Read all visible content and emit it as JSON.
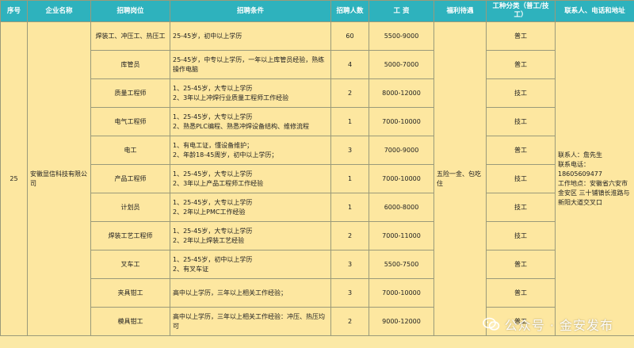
{
  "headers": {
    "seq": "序号",
    "company": "企业名称",
    "position": "招聘岗位",
    "conditions": "招聘条件",
    "count": "招聘人数",
    "salary": "工 资",
    "benefits": "福利待遇",
    "worktype": "工种分类（普工/技工）",
    "contact": "联系人、电话和地址"
  },
  "record": {
    "seq": "25",
    "company": "安徽显信科技有限公司",
    "benefits": "五险一金、包吃住",
    "contact": {
      "person": "联系人：詹先生",
      "phone": "联系电话：18605609477",
      "address": "工作地点：安徽省六安市金安区 三十铺镇长淮路与新阳大道交叉口"
    }
  },
  "rows": [
    {
      "position": "焊装工、冲压工、热压工",
      "conditions": [
        "25-45岁，初中以上学历"
      ],
      "count": "60",
      "salary": "5500-9000",
      "type": "普工"
    },
    {
      "position": "库管员",
      "conditions": [
        "25-45岁，中专以上学历，一年以上库管员经验，熟练操作电脑"
      ],
      "count": "4",
      "salary": "5000-7000",
      "type": "普工"
    },
    {
      "position": "质量工程师",
      "conditions": [
        "1、25-45岁，大专以上学历",
        "2、3年以上冲焊行业质量工程师工作经验"
      ],
      "count": "2",
      "salary": "8000-12000",
      "type": "技工"
    },
    {
      "position": "电气工程师",
      "conditions": [
        "1、25-45岁，大专以上学历",
        "2、熟悉PLC编程、熟悉冲焊设备结构、维修流程"
      ],
      "count": "1",
      "salary": "7000-10000",
      "type": "技工"
    },
    {
      "position": "电工",
      "conditions": [
        "1、有电工证，懂设备维护；",
        "2、年龄18-45周岁，初中以上学历；"
      ],
      "count": "3",
      "salary": "7000-9000",
      "type": "普工"
    },
    {
      "position": "产品工程师",
      "conditions": [
        "1、25-45岁，大专以上学历",
        "2、3年以上产品工程师工作经验"
      ],
      "count": "1",
      "salary": "7000-10000",
      "type": "技工"
    },
    {
      "position": "计划员",
      "conditions": [
        "1、25-45岁，大专以上学历",
        "2、2年以上PMC工作经验"
      ],
      "count": "1",
      "salary": "6000-8000",
      "type": "技工"
    },
    {
      "position": "焊装工艺工程师",
      "conditions": [
        "1、25-45岁，大专以上学历",
        "2、2年以上焊装工艺经验"
      ],
      "count": "2",
      "salary": "7000-11000",
      "type": "技工"
    },
    {
      "position": "叉车工",
      "conditions": [
        "1、25-45岁，初中以上学历",
        "2、有叉车证"
      ],
      "count": "3",
      "salary": "5500-7500",
      "type": "普工"
    },
    {
      "position": "夹具钳工",
      "conditions": [
        "高中以上学历，三年以上相关工作经验；"
      ],
      "count": "3",
      "salary": "7000-10000",
      "type": "普工"
    },
    {
      "position": "模具钳工",
      "conditions": [
        "高中以上学历，三年以上相关工作经验：冲压、热压均可"
      ],
      "count": "2",
      "salary": "9000-12000",
      "type": "普工"
    }
  ],
  "watermark": "公众号 · 金安发布",
  "colors": {
    "header_bg": "#2eb2bd",
    "cell_bg": "#fde7a0",
    "border": "#9a9a7a"
  }
}
